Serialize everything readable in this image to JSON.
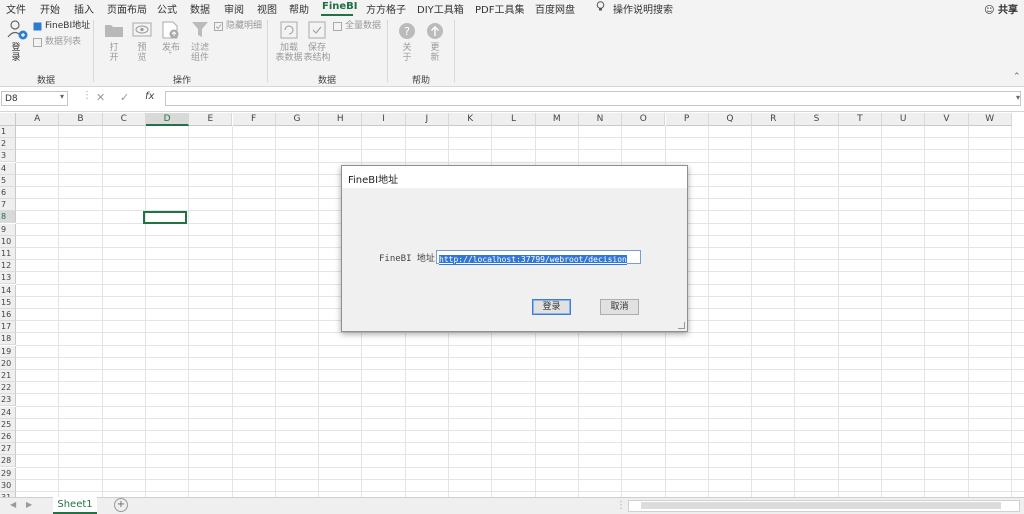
{
  "menu": {
    "tabs": [
      "文件",
      "开始",
      "插入",
      "页面布局",
      "公式",
      "数据",
      "审阅",
      "视图",
      "帮助",
      "FineBI",
      "方方格子",
      "DIY工具箱",
      "PDF工具集",
      "百度网盘"
    ],
    "active_tab": "FineBI",
    "search_label": "操作说明搜索",
    "share_label": "共享"
  },
  "ribbon": {
    "login_label": "登\n录",
    "finebi_addr_label": "FineBI地址",
    "data_list_label": "数据列表",
    "group_data": "数据",
    "open_label": "打\n开",
    "preview_label": "预\n览",
    "publish_label": "发布",
    "filter_label": "过滤\n组件",
    "hide_detail_label": "隐藏明细",
    "group_ops": "操作",
    "load_data_label": "加载\n表数据",
    "save_struct_label": "保存\n表结构",
    "all_data_label": "全量数据",
    "group_data2": "数据",
    "about_label": "关\n于",
    "update_label": "更\n新",
    "group_help": "帮助"
  },
  "formula_bar": {
    "name_box": "D8",
    "fx_label": "fx",
    "value": ""
  },
  "grid": {
    "columns": [
      "A",
      "B",
      "C",
      "D",
      "E",
      "F",
      "G",
      "H",
      "I",
      "J",
      "K",
      "L",
      "M",
      "N",
      "O",
      "P",
      "Q",
      "R",
      "S",
      "T",
      "U",
      "V",
      "W"
    ],
    "rows": 31,
    "selected_column": "D",
    "selected_row": 8
  },
  "sheet_tabs": {
    "tabs": [
      "Sheet1"
    ],
    "add_label": "+"
  },
  "dialog": {
    "title": "FineBI地址",
    "field_label": "FineBI 地址：",
    "field_value": "http://localhost:37799/webroot/decision",
    "login_button": "登录",
    "cancel_button": "取消"
  },
  "colors": {
    "accent": "#217346",
    "selection": "#3077d6"
  }
}
